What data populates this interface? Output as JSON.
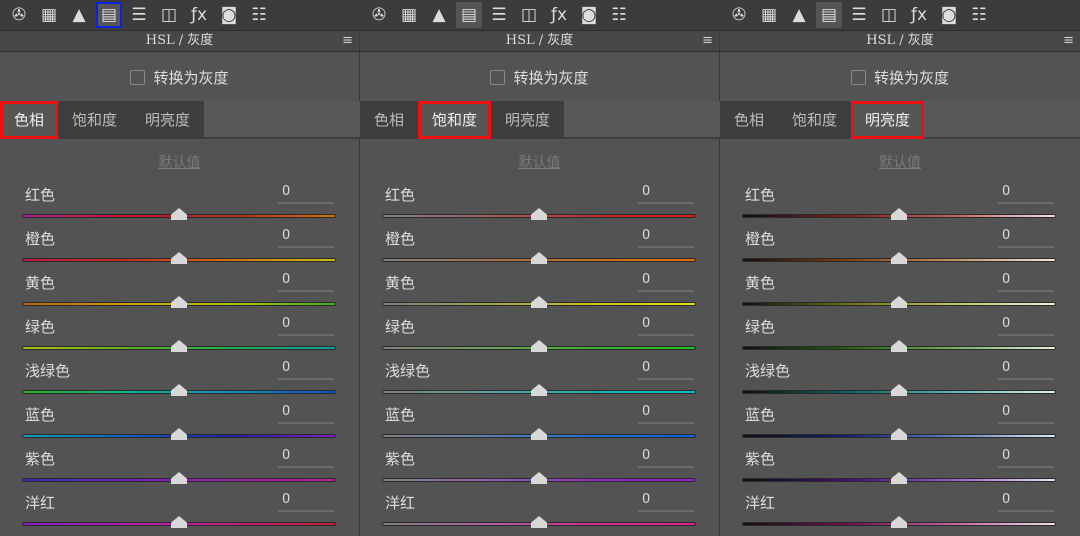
{
  "toolbar_icons": [
    "aperture-icon",
    "tone-curve-icon",
    "detail-icon",
    "hsl-icon",
    "split-toning-icon",
    "lens-icon",
    "fx-icon",
    "camera-calibration-icon",
    "presets-icon"
  ],
  "header": {
    "title": "HSL / 灰度"
  },
  "convert_gray": "转换为灰度",
  "tabs": [
    "色相",
    "饱和度",
    "明亮度"
  ],
  "default_link": "默认值",
  "colors": [
    "红色",
    "橙色",
    "黄色",
    "绿色",
    "浅绿色",
    "蓝色",
    "紫色",
    "洋红"
  ],
  "value": "0",
  "highlight_colors": {
    "tab": "#f01010",
    "toolbar": "#1020e0"
  },
  "panels": [
    {
      "active_tab": 0,
      "gradients": [
        [
          "#b0208a",
          "#c01830",
          "#b03020",
          "#d07010"
        ],
        [
          "#c01840",
          "#c03020",
          "#d07010",
          "#c8c010"
        ],
        [
          "#c06010",
          "#c8a010",
          "#b0c010",
          "#40b020"
        ],
        [
          "#b0c010",
          "#60b020",
          "#20b050",
          "#10a0a0"
        ],
        [
          "#30b020",
          "#10b090",
          "#1090c0",
          "#1050c0"
        ],
        [
          "#10a0b0",
          "#1060c0",
          "#2020a0",
          "#8020c0"
        ],
        [
          "#3030c0",
          "#7020c0",
          "#a020b0",
          "#c02090"
        ],
        [
          "#8020c0",
          "#b020b0",
          "#c02080",
          "#c02030"
        ]
      ]
    },
    {
      "active_tab": 1,
      "gradients": [
        [
          "#808080",
          "#a06060",
          "#c03030",
          "#d02020"
        ],
        [
          "#808080",
          "#a07050",
          "#c07020",
          "#e07010"
        ],
        [
          "#808080",
          "#a0a050",
          "#c8c020",
          "#e0e010"
        ],
        [
          "#808080",
          "#70a060",
          "#40b030",
          "#20c020"
        ],
        [
          "#808080",
          "#60a0a0",
          "#20b0b0",
          "#10c0c0"
        ],
        [
          "#808080",
          "#6080b0",
          "#2070d0",
          "#1060e0"
        ],
        [
          "#808080",
          "#9060b0",
          "#9030c0",
          "#9020d0"
        ],
        [
          "#808080",
          "#b060a0",
          "#d03090",
          "#e02090"
        ]
      ]
    },
    {
      "active_tab": 2,
      "gradients": [
        [
          "#101010",
          "#802020",
          "#c06060",
          "#f0e0e0"
        ],
        [
          "#101010",
          "#804010",
          "#c09060",
          "#f0e8e0"
        ],
        [
          "#101010",
          "#707010",
          "#c0c060",
          "#f0f0e0"
        ],
        [
          "#101010",
          "#206010",
          "#70b060",
          "#e8f0e0"
        ],
        [
          "#101010",
          "#106060",
          "#60b0b0",
          "#e0f0f0"
        ],
        [
          "#101010",
          "#102070",
          "#6080c0",
          "#e0e8f0"
        ],
        [
          "#101010",
          "#401070",
          "#9060c0",
          "#ece0f0"
        ],
        [
          "#101010",
          "#701050",
          "#c060a0",
          "#f0e0e8"
        ]
      ]
    }
  ]
}
